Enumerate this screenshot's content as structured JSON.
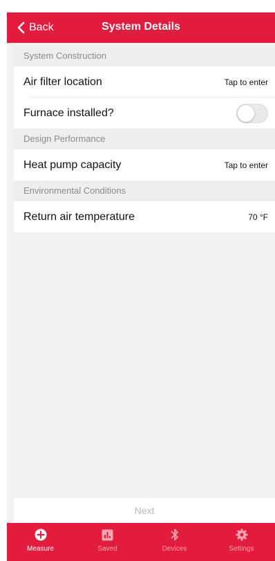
{
  "header": {
    "back_label": "Back",
    "title": "System Details"
  },
  "sections": [
    {
      "title": "System Construction",
      "rows": [
        {
          "label": "Air filter location",
          "value": "Tap to enter"
        },
        {
          "label": "Furnace installed?",
          "toggle_on": false
        }
      ]
    },
    {
      "title": "Design Performance",
      "rows": [
        {
          "label": "Heat pump capacity",
          "value": "Tap to enter"
        }
      ]
    },
    {
      "title": "Environmental Conditions",
      "rows": [
        {
          "label": "Return air temperature",
          "value": "70 °F"
        }
      ]
    }
  ],
  "footer": {
    "next_label": "Next"
  },
  "tabs": [
    {
      "label": "Measure",
      "icon": "plus-circle-icon",
      "active": true
    },
    {
      "label": "Saved",
      "icon": "bar-chart-icon",
      "active": false
    },
    {
      "label": "Devices",
      "icon": "bluetooth-icon",
      "active": false
    },
    {
      "label": "Settings",
      "icon": "gear-icon",
      "active": false
    }
  ],
  "colors": {
    "brand_red": "#e31c3d",
    "background": "#f2f2f4",
    "section_text": "#8a8a8e",
    "disabled_text": "#b9b9bd"
  }
}
